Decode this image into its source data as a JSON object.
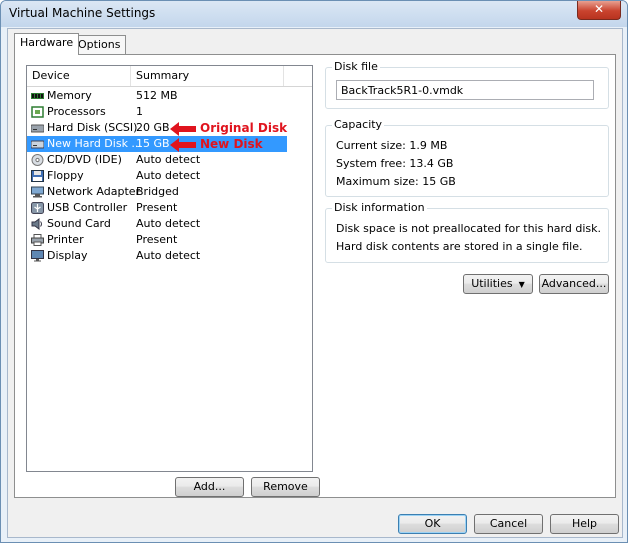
{
  "window": {
    "title": "Virtual Machine Settings",
    "close_label": "✕"
  },
  "tabs": [
    {
      "label": "Hardware"
    },
    {
      "label": "Options"
    }
  ],
  "device_list": {
    "headers": {
      "device": "Device",
      "summary": "Summary"
    },
    "rows": [
      {
        "device": "Memory",
        "summary": "512 MB",
        "icon": "memory-icon"
      },
      {
        "device": "Processors",
        "summary": "1",
        "icon": "processor-icon"
      },
      {
        "device": "Hard Disk (SCSI)",
        "summary": "20 GB",
        "icon": "hard-disk-icon"
      },
      {
        "device": "New Hard Disk ...",
        "summary": "15 GB",
        "icon": "hard-disk-icon",
        "selected": true
      },
      {
        "device": "CD/DVD (IDE)",
        "summary": "Auto detect",
        "icon": "cd-dvd-icon"
      },
      {
        "device": "Floppy",
        "summary": "Auto detect",
        "icon": "floppy-icon"
      },
      {
        "device": "Network Adapter",
        "summary": "Bridged",
        "icon": "network-adapter-icon"
      },
      {
        "device": "USB Controller",
        "summary": "Present",
        "icon": "usb-icon"
      },
      {
        "device": "Sound Card",
        "summary": "Auto detect",
        "icon": "speaker-icon"
      },
      {
        "device": "Printer",
        "summary": "Present",
        "icon": "printer-icon"
      },
      {
        "device": "Display",
        "summary": "Auto detect",
        "icon": "display-icon"
      }
    ],
    "add_label": "Add...",
    "remove_label": "Remove"
  },
  "annotations": {
    "original": "Original Disk",
    "new": "New Disk",
    "color": "#e0141e"
  },
  "disk_file": {
    "title": "Disk file",
    "value": "BackTrack5R1-0.vmdk"
  },
  "capacity": {
    "title": "Capacity",
    "current": "Current size:  1.9 MB",
    "free": "System free:  13.4 GB",
    "max": "Maximum size:  15 GB"
  },
  "disk_info": {
    "title": "Disk information",
    "line1": "Disk space is not preallocated for this hard disk.",
    "line2": "Hard disk contents are stored in a single file."
  },
  "utilities_label": "Utilities",
  "advanced_label": "Advanced...",
  "footer": {
    "ok": "OK",
    "cancel": "Cancel",
    "help": "Help"
  },
  "colors": {
    "selection": "#3399ff",
    "accent": "#3c7fb1"
  }
}
